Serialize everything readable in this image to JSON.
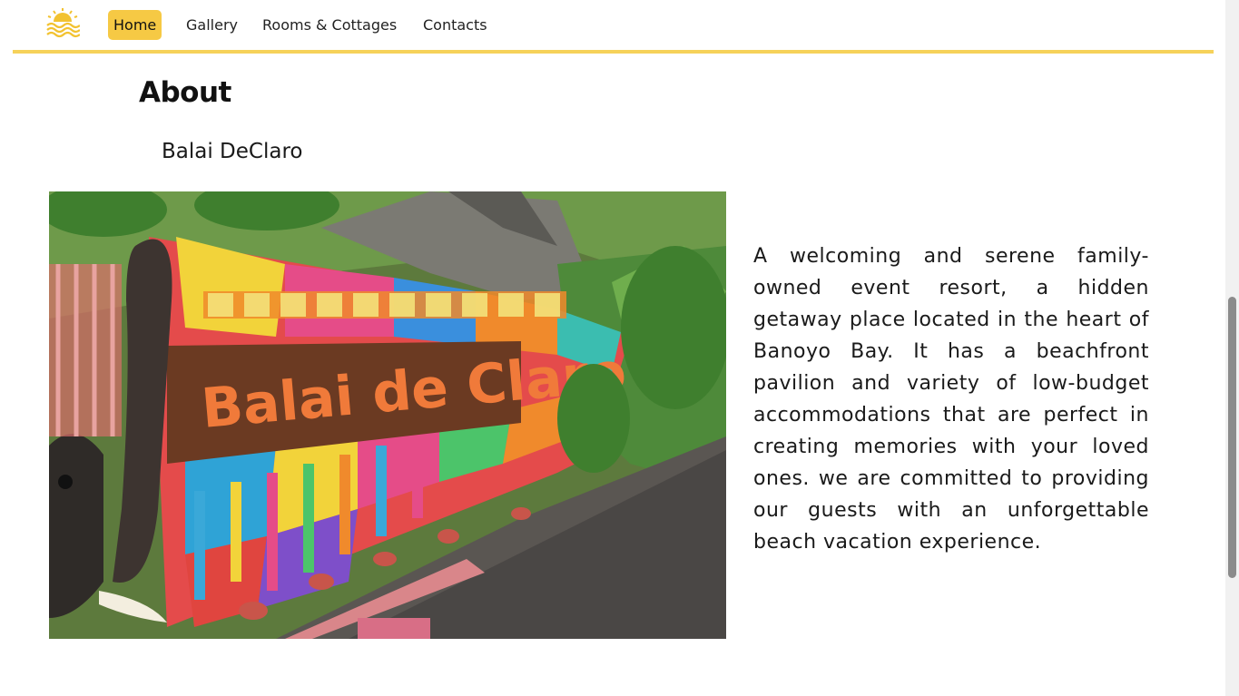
{
  "nav": {
    "logo_icon": "sun-waves-icon",
    "items": [
      {
        "label": "Home",
        "active": true
      },
      {
        "label": "Gallery",
        "active": false
      },
      {
        "label": "Rooms & Cottages",
        "active": false
      },
      {
        "label": "Contacts",
        "active": false
      }
    ]
  },
  "about": {
    "heading": "About",
    "resort_name": "Balai DeClaro",
    "photo_sign_text": "Balai de Claro",
    "description": "A welcoming and serene family-owned event resort, a hidden getaway place located in the heart of Banoyo Bay. It has a beachfront pavilion and variety of low-budget accommodations that are perfect in creating memories with your loved ones. we are committed to providing our guests with an unforgettable beach vacation experience."
  },
  "colors": {
    "accent": "#f6c944",
    "nav_border": "#f6d25a"
  }
}
